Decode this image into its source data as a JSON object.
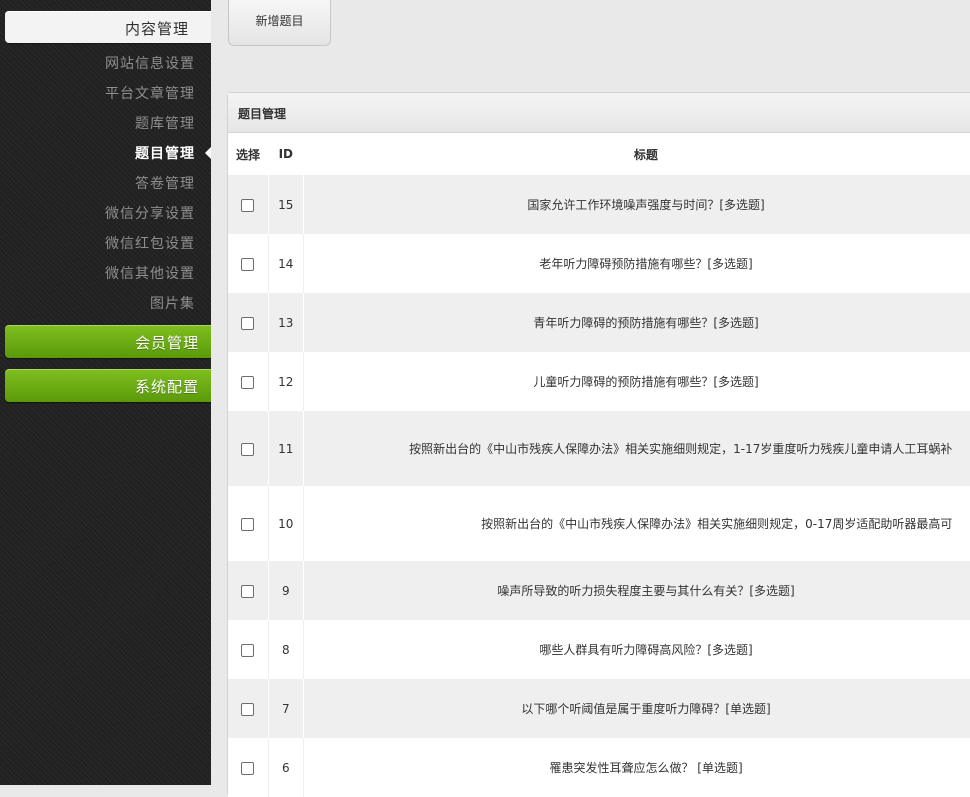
{
  "sidebar": {
    "section_title": "内容管理",
    "items": [
      {
        "label": "网站信息设置",
        "active": false
      },
      {
        "label": "平台文章管理",
        "active": false
      },
      {
        "label": "题库管理",
        "active": false
      },
      {
        "label": "题目管理",
        "active": true
      },
      {
        "label": "答卷管理",
        "active": false
      },
      {
        "label": "微信分享设置",
        "active": false
      },
      {
        "label": "微信红包设置",
        "active": false
      },
      {
        "label": "微信其他设置",
        "active": false
      },
      {
        "label": "图片集",
        "active": false
      }
    ],
    "member_label": "会员管理",
    "system_label": "系统配置",
    "accent_color": "#6aad14"
  },
  "toolbar": {
    "add_label": "新增题目"
  },
  "panel": {
    "title": "题目管理"
  },
  "table": {
    "headers": {
      "select": "选择",
      "id": "ID",
      "title": "标题"
    },
    "rows": [
      {
        "id": "15",
        "title": "国家允许工作环境噪声强度与时间？[多选题]"
      },
      {
        "id": "14",
        "title": "老年听力障碍预防措施有哪些？[多选题]"
      },
      {
        "id": "13",
        "title": "青年听力障碍的预防措施有哪些？[多选题]"
      },
      {
        "id": "12",
        "title": "儿童听力障碍的预防措施有哪些？[多选题]"
      },
      {
        "id": "11",
        "title": "按照新出台的《中山市残疾人保障办法》相关实施细则规定，1-17岁重度听力残疾儿童申请人工耳蜗补"
      },
      {
        "id": "10",
        "title": "按照新出台的《中山市残疾人保障办法》相关实施细则规定，0-17周岁适配助听器最高可"
      },
      {
        "id": "9",
        "title": "噪声所导致的听力损失程度主要与其什么有关？[多选题]"
      },
      {
        "id": "8",
        "title": "哪些人群具有听力障碍高风险？[多选题]"
      },
      {
        "id": "7",
        "title": "以下哪个听阈值是属于重度听力障碍？[单选题]"
      },
      {
        "id": "6",
        "title": "罹患突发性耳聋应怎么做？ [单选题]"
      }
    ]
  }
}
